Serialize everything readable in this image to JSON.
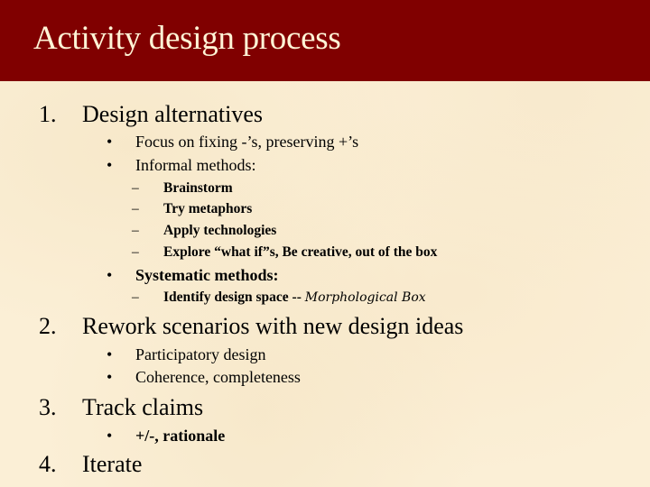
{
  "slide": {
    "title": "Activity design process",
    "colors": {
      "header_bg": "#800000",
      "title_text": "#fff4d6",
      "background": "#fbefd6",
      "body_text": "#000000"
    },
    "sections": [
      {
        "number": "1.",
        "heading": "Design alternatives",
        "items": [
          {
            "bullet": "•",
            "text": "Focus on fixing -’s, preserving +’s"
          },
          {
            "bullet": "•",
            "text": "Informal methods:",
            "subitems": [
              {
                "dash": "–",
                "text": "Brainstorm"
              },
              {
                "dash": "–",
                "text": "Try metaphors"
              },
              {
                "dash": "–",
                "text": "Apply technologies"
              },
              {
                "dash": "–",
                "text": "Explore “what if”s, Be creative, out of the box"
              }
            ]
          },
          {
            "bullet": "•",
            "text": "Systematic methods:",
            "subitems": [
              {
                "dash": "–",
                "text": "Identify design space -- ",
                "emphasis": "Morphological Box"
              }
            ]
          }
        ]
      },
      {
        "number": "2.",
        "heading": "Rework scenarios with new design ideas",
        "items": [
          {
            "bullet": "•",
            "text": "Participatory design"
          },
          {
            "bullet": "•",
            "text": "Coherence, completeness"
          }
        ]
      },
      {
        "number": "3.",
        "heading": "Track claims",
        "items": [
          {
            "bullet": "•",
            "text": "+/-, rationale"
          }
        ]
      },
      {
        "number": "4.",
        "heading": "Iterate",
        "items": []
      }
    ]
  }
}
